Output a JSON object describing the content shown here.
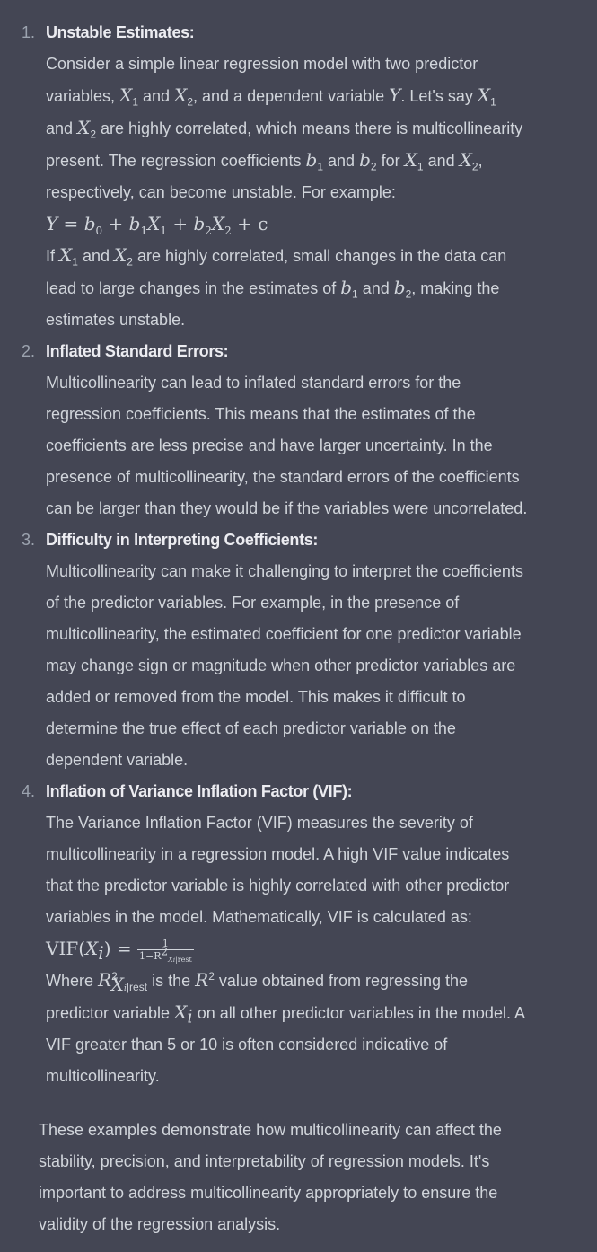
{
  "items": [
    {
      "num": "1.",
      "heading": "Unstable Estimates:",
      "l1": "Consider a simple linear regression model with two predictor",
      "l2a": "variables,",
      "x1": "X",
      "s1": "1",
      "and": "and",
      "x2": "X",
      "s2": "2",
      "l2b": ", and a dependent variable",
      "y": "Y",
      "l2c": ". Let's say",
      "l3a": "and",
      "l3b": "are highly correlated, which means there is multicollinearity",
      "l4a": "present. The regression coefficients",
      "b": "b",
      "l4b": "for",
      "l4c": "and",
      "l5": "respectively, can become unstable. For example:",
      "eq": "Y = b",
      "eq_tail": " + ϵ",
      "l7a": "If",
      "l7b": "are highly correlated, small changes in the data can",
      "l8a": "lead to large changes in the estimates of",
      "l8b": ", making the",
      "l9": "estimates unstable."
    },
    {
      "num": "2.",
      "heading": "Inflated Standard Errors:",
      "lines": [
        "Multicollinearity can lead to inflated standard errors for the",
        "regression coefficients. This means that the estimates of the",
        "coefficients are less precise and have larger uncertainty. In the",
        "presence of multicollinearity, the standard errors of the coefficients",
        "can be larger than they would be if the variables were uncorrelated."
      ]
    },
    {
      "num": "3.",
      "heading": "Difficulty in Interpreting Coefficients:",
      "lines": [
        "Multicollinearity can make it challenging to interpret the coefficients",
        "of the predictor variables. For example, in the presence of",
        "multicollinearity, the estimated coefficient for one predictor variable",
        "may change sign or magnitude when other predictor variables are",
        "added or removed from the model. This makes it difficult to",
        "determine the true effect of each predictor variable on the",
        "dependent variable."
      ]
    },
    {
      "num": "4.",
      "heading": "Inflation of Variance Inflation Factor (VIF):",
      "lines": [
        "The Variance Inflation Factor (VIF) measures the severity of",
        "multicollinearity in a regression model. A high VIF value indicates",
        "that the predictor variable is highly correlated with other predictor",
        "variables in the model. Mathematically, VIF is calculated as:"
      ],
      "vif": "VIF",
      "xi": "X",
      "i": "i",
      "one": "1",
      "den": "1−R",
      "rest": "rest",
      "where": "Where",
      "isthe": "is the",
      "r": "R",
      "sq": "2",
      "w_tail": "value obtained from regressing the",
      "p2a": "predictor variable",
      "p2b": "on all other predictor variables in the model. A",
      "p3": "VIF greater than 5 or 10 is often considered indicative of",
      "p4": "multicollinearity."
    }
  ],
  "summary": [
    "These examples demonstrate how multicollinearity can affect the",
    "stability, precision, and interpretability of regression models. It's",
    "important to address multicollinearity appropriately to ensure the",
    "validity of the regression analysis."
  ],
  "colors": {
    "background": "#444654",
    "text": "#d1d5db",
    "heading": "#ececf1",
    "number": "#9ca3af"
  }
}
